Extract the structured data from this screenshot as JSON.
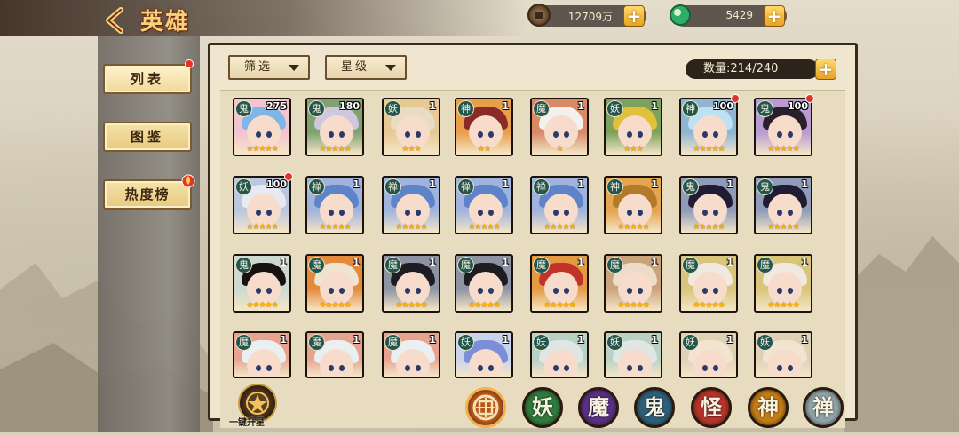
{
  "header": {
    "title": "英雄",
    "back_icon": "chevron-left-icon"
  },
  "currencies": [
    {
      "name": "coins",
      "icon": "coin-icon",
      "value": "12709万"
    },
    {
      "name": "jade",
      "icon": "jade-icon",
      "value": "5429"
    }
  ],
  "sidebar": {
    "items": [
      {
        "label": "列表",
        "active": true,
        "badge": true
      },
      {
        "label": "图鉴",
        "active": false,
        "badge": false
      },
      {
        "label": "热度榜",
        "active": false,
        "badge": true
      }
    ]
  },
  "filters": {
    "filter_label": "筛选",
    "star_label": "星级"
  },
  "count": {
    "label": "数量:214/240"
  },
  "colors": {
    "accent": "#e7a323",
    "badge": "#e5332a",
    "star": "#ffb300"
  },
  "heroes": [
    {
      "faction": "鬼",
      "level": "275",
      "stars": "★★★★★",
      "badge": false,
      "hair": "#7fb6e8",
      "bg": "#f2c4cf"
    },
    {
      "faction": "鬼",
      "level": "180",
      "stars": "★★★★★",
      "badge": false,
      "hair": "#cfc7dd",
      "bg": "#7fa26f"
    },
    {
      "faction": "妖",
      "level": "1",
      "stars": "★★★",
      "badge": false,
      "hair": "#e9dcc4",
      "bg": "#e7c993"
    },
    {
      "faction": "神",
      "level": "1",
      "stars": "★★",
      "badge": false,
      "hair": "#8a2a26",
      "bg": "#e99f4a"
    },
    {
      "faction": "魔",
      "level": "1",
      "stars": "★",
      "badge": false,
      "hair": "#f3f0ee",
      "bg": "#d88a67"
    },
    {
      "faction": "妖",
      "level": "1",
      "stars": "★★★",
      "badge": false,
      "hair": "#e1c03c",
      "bg": "#7da25c"
    },
    {
      "faction": "神",
      "level": "100",
      "stars": "★★★★★",
      "badge": true,
      "hair": "#bde0f2",
      "bg": "#8fb5d2"
    },
    {
      "faction": "鬼",
      "level": "100",
      "stars": "★★★★★",
      "badge": true,
      "hair": "#2a1f2a",
      "bg": "#b99bd1"
    },
    {
      "faction": "妖",
      "level": "100",
      "stars": "★★★★★",
      "badge": true,
      "hair": "#e7eaf3",
      "bg": "#bcc7de"
    },
    {
      "faction": "禅",
      "level": "1",
      "stars": "★★★★★",
      "badge": false,
      "hair": "#5e83c8",
      "bg": "#9fb3dc"
    },
    {
      "faction": "禅",
      "level": "1",
      "stars": "★★★★★",
      "badge": false,
      "hair": "#5e83c8",
      "bg": "#9fb3dc"
    },
    {
      "faction": "禅",
      "level": "1",
      "stars": "★★★★★",
      "badge": false,
      "hair": "#5e83c8",
      "bg": "#9fb3dc"
    },
    {
      "faction": "禅",
      "level": "1",
      "stars": "★★★★★",
      "badge": false,
      "hair": "#5e83c8",
      "bg": "#9fb3dc"
    },
    {
      "faction": "神",
      "level": "1",
      "stars": "★★★★★",
      "badge": false,
      "hair": "#b37a2a",
      "bg": "#e4a450"
    },
    {
      "faction": "鬼",
      "level": "1",
      "stars": "★★★★★",
      "badge": false,
      "hair": "#1f1c33",
      "bg": "#8f9bb8"
    },
    {
      "faction": "鬼",
      "level": "1",
      "stars": "★★★★★",
      "badge": false,
      "hair": "#1f1c33",
      "bg": "#8f9bb8"
    },
    {
      "faction": "鬼",
      "level": "1",
      "stars": "★★★★★",
      "badge": false,
      "hair": "#17120f",
      "bg": "#cdd8cf"
    },
    {
      "faction": "魔",
      "level": "1",
      "stars": "★★★★★",
      "badge": false,
      "hair": "#efe4d0",
      "bg": "#e58a3a"
    },
    {
      "faction": "魔",
      "level": "1",
      "stars": "★★★★★",
      "badge": false,
      "hair": "#1d1c22",
      "bg": "#8d93a2"
    },
    {
      "faction": "魔",
      "level": "1",
      "stars": "★★★★★",
      "badge": false,
      "hair": "#1d1c22",
      "bg": "#8d93a2"
    },
    {
      "faction": "魔",
      "level": "1",
      "stars": "★★★★★",
      "badge": false,
      "hair": "#c2332a",
      "bg": "#e39a40"
    },
    {
      "faction": "魔",
      "level": "1",
      "stars": "★★★★★",
      "badge": false,
      "hair": "#ecdcc8",
      "bg": "#caa37a"
    },
    {
      "faction": "魔",
      "level": "1",
      "stars": "★★★★★",
      "badge": false,
      "hair": "#f0e9e0",
      "bg": "#d8c47a"
    },
    {
      "faction": "魔",
      "level": "1",
      "stars": "★★★★★",
      "badge": false,
      "hair": "#f0e9e0",
      "bg": "#d8c47a"
    },
    {
      "faction": "魔",
      "level": "1",
      "stars": "",
      "badge": false,
      "hair": "#eaf0f2",
      "bg": "#e7a38f"
    },
    {
      "faction": "魔",
      "level": "1",
      "stars": "",
      "badge": false,
      "hair": "#eaf0f2",
      "bg": "#e7a38f"
    },
    {
      "faction": "魔",
      "level": "1",
      "stars": "",
      "badge": false,
      "hair": "#eaf0f2",
      "bg": "#e7a38f"
    },
    {
      "faction": "妖",
      "level": "1",
      "stars": "",
      "badge": false,
      "hair": "#7d8ed8",
      "bg": "#c9d4ec"
    },
    {
      "faction": "妖",
      "level": "1",
      "stars": "",
      "badge": false,
      "hair": "#dfe6e4",
      "bg": "#b9d1c4"
    },
    {
      "faction": "妖",
      "level": "1",
      "stars": "",
      "badge": false,
      "hair": "#dfe6e4",
      "bg": "#b9d1c4"
    },
    {
      "faction": "妖",
      "level": "1",
      "stars": "",
      "badge": false,
      "hair": "#f1e4d0",
      "bg": "#ded1b6"
    },
    {
      "faction": "妖",
      "level": "1",
      "stars": "",
      "badge": false,
      "hair": "#f1e4d0",
      "bg": "#ded1b6"
    }
  ],
  "bottom": {
    "upstar_label": "一键升星",
    "factions": [
      {
        "label": "",
        "name": "all",
        "color": "#b8561e"
      },
      {
        "label": "妖",
        "name": "yao",
        "color": "#2f7a3c"
      },
      {
        "label": "魔",
        "name": "mo",
        "color": "#5a2f86"
      },
      {
        "label": "鬼",
        "name": "gui",
        "color": "#2b5f7a"
      },
      {
        "label": "怪",
        "name": "guai",
        "color": "#b8342a"
      },
      {
        "label": "神",
        "name": "shen",
        "color": "#c47c16"
      },
      {
        "label": "禅",
        "name": "chan",
        "color": "#8fa3a8"
      }
    ]
  }
}
